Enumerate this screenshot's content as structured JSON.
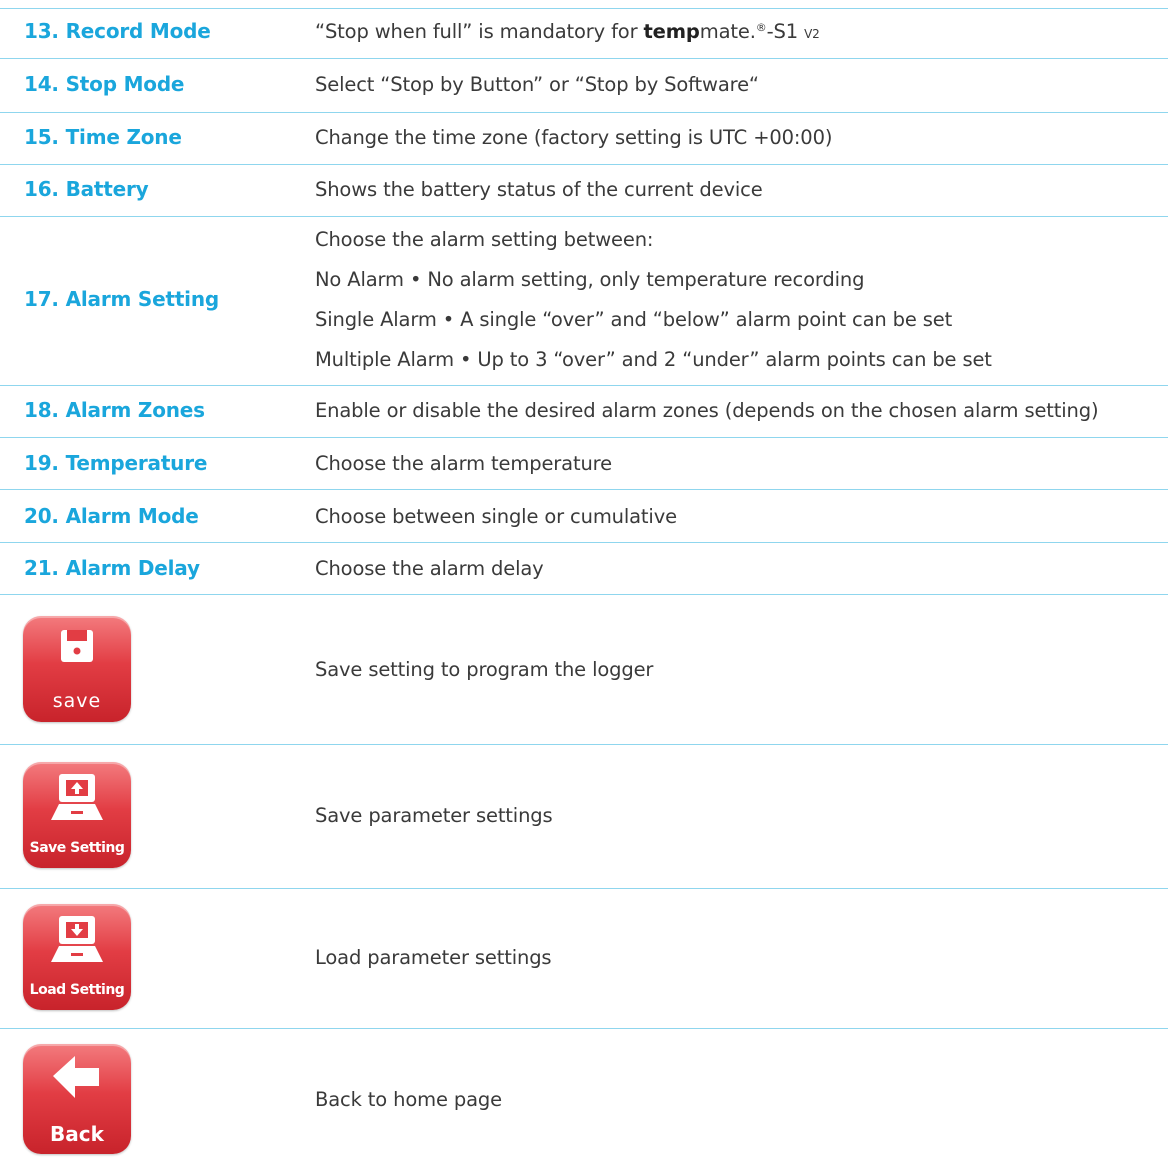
{
  "rows": [
    {
      "label": "13. Record Mode",
      "desc": {
        "q1": "“Stop when full” is mandatory for ",
        "bold": "temp",
        "after": "mate.",
        "sup": "®",
        "tail": "-S1 ",
        "small": "V2"
      }
    },
    {
      "label": "14. Stop Mode",
      "desc": "Select “Stop by Button” or “Stop by Software“"
    },
    {
      "label": "15. Time Zone",
      "desc": "Change the time zone (factory setting is UTC +00:00)"
    },
    {
      "label": "16. Battery",
      "desc": "Shows the battery status of the current device"
    },
    {
      "label": "17. Alarm Setting",
      "lines": [
        "Choose the alarm setting between:",
        "No Alarm • No alarm setting, only temperature recording",
        "Single Alarm • A single “over” and “below” alarm point can be set",
        "Multiple Alarm • Up to 3 “over” and 2 “under” alarm points can be set"
      ]
    },
    {
      "label": "18. Alarm Zones",
      "desc": "Enable or disable the desired alarm zones (depends on the chosen alarm setting)"
    },
    {
      "label": "19. Temperature",
      "desc": "Choose the alarm temperature"
    },
    {
      "label": "20. Alarm Mode",
      "desc": "Choose between single or cumulative"
    },
    {
      "label": "21. Alarm Delay",
      "desc": "Choose the alarm delay"
    }
  ],
  "buttons": [
    {
      "caption": "save",
      "icon": "floppy-disk-icon",
      "desc": "Save setting to program the logger"
    },
    {
      "caption": "Save Setting",
      "icon": "laptop-upload-icon",
      "desc": "Save parameter settings"
    },
    {
      "caption": "Load Setting",
      "icon": "laptop-download-icon",
      "desc": "Load parameter settings"
    },
    {
      "caption": "Back",
      "icon": "arrow-left-icon",
      "desc": "Back to home page"
    }
  ],
  "colors": {
    "accent": "#1aa6dc",
    "rule": "#8fd6ee",
    "button_red": "#e23d44",
    "text": "#3a3a3a"
  }
}
